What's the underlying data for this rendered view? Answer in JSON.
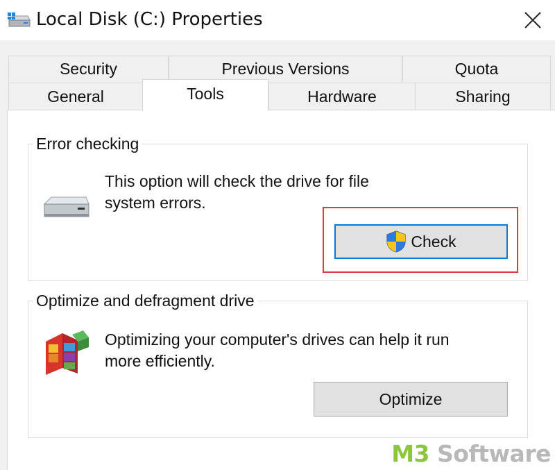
{
  "window": {
    "title": "Local Disk (C:) Properties",
    "icon": "drive-icon",
    "close_icon": "close-icon"
  },
  "tabs": {
    "row1": [
      {
        "label": "Security"
      },
      {
        "label": "Previous Versions"
      },
      {
        "label": "Quota"
      }
    ],
    "row2": [
      {
        "label": "General"
      },
      {
        "label": "Tools",
        "active": true
      },
      {
        "label": "Hardware"
      },
      {
        "label": "Sharing"
      }
    ]
  },
  "error_checking": {
    "title": "Error checking",
    "icon": "hard-drive-icon",
    "description_line1": "This option will check the drive for file",
    "description_line2": "system errors.",
    "button_label": "Check",
    "button_icon": "uac-shield-icon"
  },
  "optimize": {
    "title": "Optimize and defragment drive",
    "icon": "defrag-icon",
    "description_line1": "Optimizing your computer's drives can help it run",
    "description_line2": "more efficiently.",
    "button_label": "Optimize"
  },
  "watermark": {
    "brand_part1": "M3",
    "brand_part2": " Software",
    "colors": {
      "m3": "#8cc63f",
      "software": "#b8b8b8"
    }
  },
  "colors": {
    "highlight_border": "#e03a3a",
    "default_button_border": "#0078d7"
  }
}
